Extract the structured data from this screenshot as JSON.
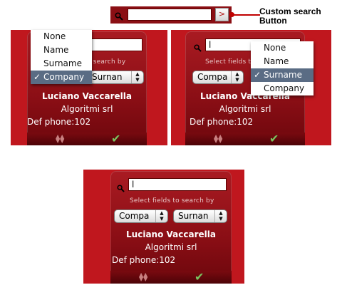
{
  "callout": {
    "text": "Custom search\nButton"
  },
  "top_search": {
    "button_glyph": ">",
    "value": ""
  },
  "panel": {
    "hint": "Select fields to search by",
    "contact_name": "Luciano Vaccarella",
    "contact_company": "Algoritmi srl",
    "contact_phone": "Def phone:102",
    "search_value": "l",
    "left_select": "Compa",
    "right_select": "Surnan",
    "right_select_full": "Surnan"
  },
  "left_panel": {
    "hint_partial": "o search by",
    "options": [
      {
        "label": "None",
        "selected": false
      },
      {
        "label": "Name",
        "selected": false
      },
      {
        "label": "Surname",
        "selected": false
      },
      {
        "label": "Company",
        "selected": true
      }
    ],
    "check_glyph": "✓"
  },
  "right_panel": {
    "hint_partial": "Select fields t",
    "options": [
      {
        "label": "None",
        "selected": false
      },
      {
        "label": "Name",
        "selected": false
      },
      {
        "label": "Surname",
        "selected": true
      },
      {
        "label": "Company",
        "selected": false
      }
    ],
    "check_glyph": "✓"
  },
  "bottom_panel": {
    "hint": "Select fields to search by",
    "left_select": "Compa",
    "right_select": "Surnan"
  },
  "colors": {
    "frame": "#c0171e",
    "panel": "#8a0e15",
    "selection": "#5a6c84"
  }
}
